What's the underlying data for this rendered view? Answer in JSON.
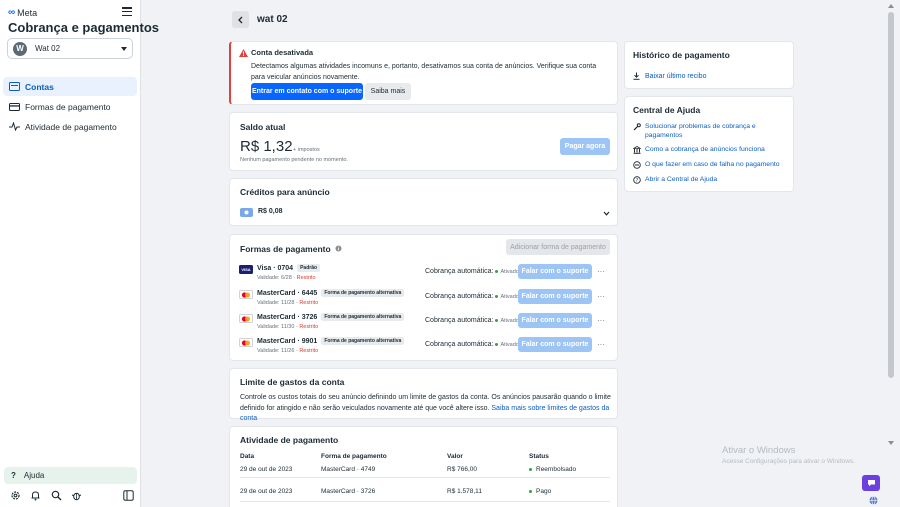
{
  "sidebar": {
    "brand": "Meta",
    "title": "Cobrança e pagamentos",
    "account": {
      "initial": "W",
      "name": "Wat 02"
    },
    "nav": [
      {
        "label": "Contas",
        "active": true
      },
      {
        "label": "Formas de pagamento",
        "active": false
      },
      {
        "label": "Atividade de pagamento",
        "active": false
      }
    ],
    "help_label": "Ajuda"
  },
  "header": {
    "title": "wat 02"
  },
  "alert": {
    "title": "Conta desativada",
    "body": "Detectamos algumas atividades incomuns e, portanto, desativamos sua conta de anúncios. Verifique sua conta para veicular anúncios novamente.",
    "primary_label": "Entrar em contato com o suporte",
    "secondary_label": "Saiba mais"
  },
  "balance": {
    "title": "Saldo atual",
    "amount": "R$ 1,32",
    "tax_note": "+ impostos",
    "sub": "Nenhum pagamento pendente no momento.",
    "pay_label": "Pagar agora"
  },
  "credits": {
    "title": "Créditos para anúncio",
    "value": "R$ 0,08"
  },
  "payment_methods": {
    "title": "Formas de pagamento",
    "add_label": "Adicionar forma de pagamento",
    "auto_label": "Cobrança automática:",
    "auto_status": "Ativado",
    "contact_label": "Falar com o suporte",
    "items": [
      {
        "brand": "visa",
        "name": "Visa · 0704",
        "badge": "Padrão",
        "validity": "Validade: 6/28 · ",
        "restricted": "Restrito"
      },
      {
        "brand": "mastercard",
        "name": "MasterCard · 6445",
        "badge": "Forma de pagamento alternativa",
        "validity": "Validade: 11/28 · ",
        "restricted": "Restrito"
      },
      {
        "brand": "mastercard",
        "name": "MasterCard · 3726",
        "badge": "Forma de pagamento alternativa",
        "validity": "Validade: 11/30 · ",
        "restricted": "Restrito"
      },
      {
        "brand": "mastercard",
        "name": "MasterCard · 9901",
        "badge": "Forma de pagamento alternativa",
        "validity": "Validade: 11/26 · ",
        "restricted": "Restrito"
      }
    ]
  },
  "spending_limit": {
    "title": "Limite de gastos da conta",
    "body": "Controle os custos totais do seu anúncio definindo um limite de gastos da conta. Os anúncios pausarão quando o limite definido for atingido e não serão veiculados novamente até que você altere isso. ",
    "link": "Saiba mais sobre limites de gastos da conta"
  },
  "activity": {
    "title": "Atividade de pagamento",
    "columns": [
      "Data",
      "Forma de pagamento",
      "Valor",
      "Status"
    ],
    "rows": [
      {
        "date": "29 de out de 2023",
        "method": "MasterCard · 4749",
        "amount": "R$ 766,00",
        "status": "Reembolsado"
      },
      {
        "date": "29 de out de 2023",
        "method": "MasterCard · 3726",
        "amount": "R$ 1.578,11",
        "status": "Pago"
      }
    ]
  },
  "history": {
    "title": "Histórico de pagamento",
    "link": "Baixar último recibo"
  },
  "help_center": {
    "title": "Central de Ajuda",
    "links": [
      {
        "icon": "wrench-icon",
        "label": "Solucionar problemas de cobrança e pagamentos"
      },
      {
        "icon": "bank-icon",
        "label": "Como a cobrança de anúncios funciona"
      },
      {
        "icon": "minus-circle-icon",
        "label": "O que fazer em caso de falha no pagamento"
      },
      {
        "icon": "question-circle-icon",
        "label": "Abrir a Central de Ajuda"
      }
    ]
  },
  "watermark": {
    "line1": "Ativar o Windows",
    "line2": "Acesse Configurações para ativar o Windows."
  },
  "colors": {
    "primary": "#0866ff",
    "danger": "#e4403b",
    "success": "#31a24c",
    "link": "#0a5ec2"
  }
}
